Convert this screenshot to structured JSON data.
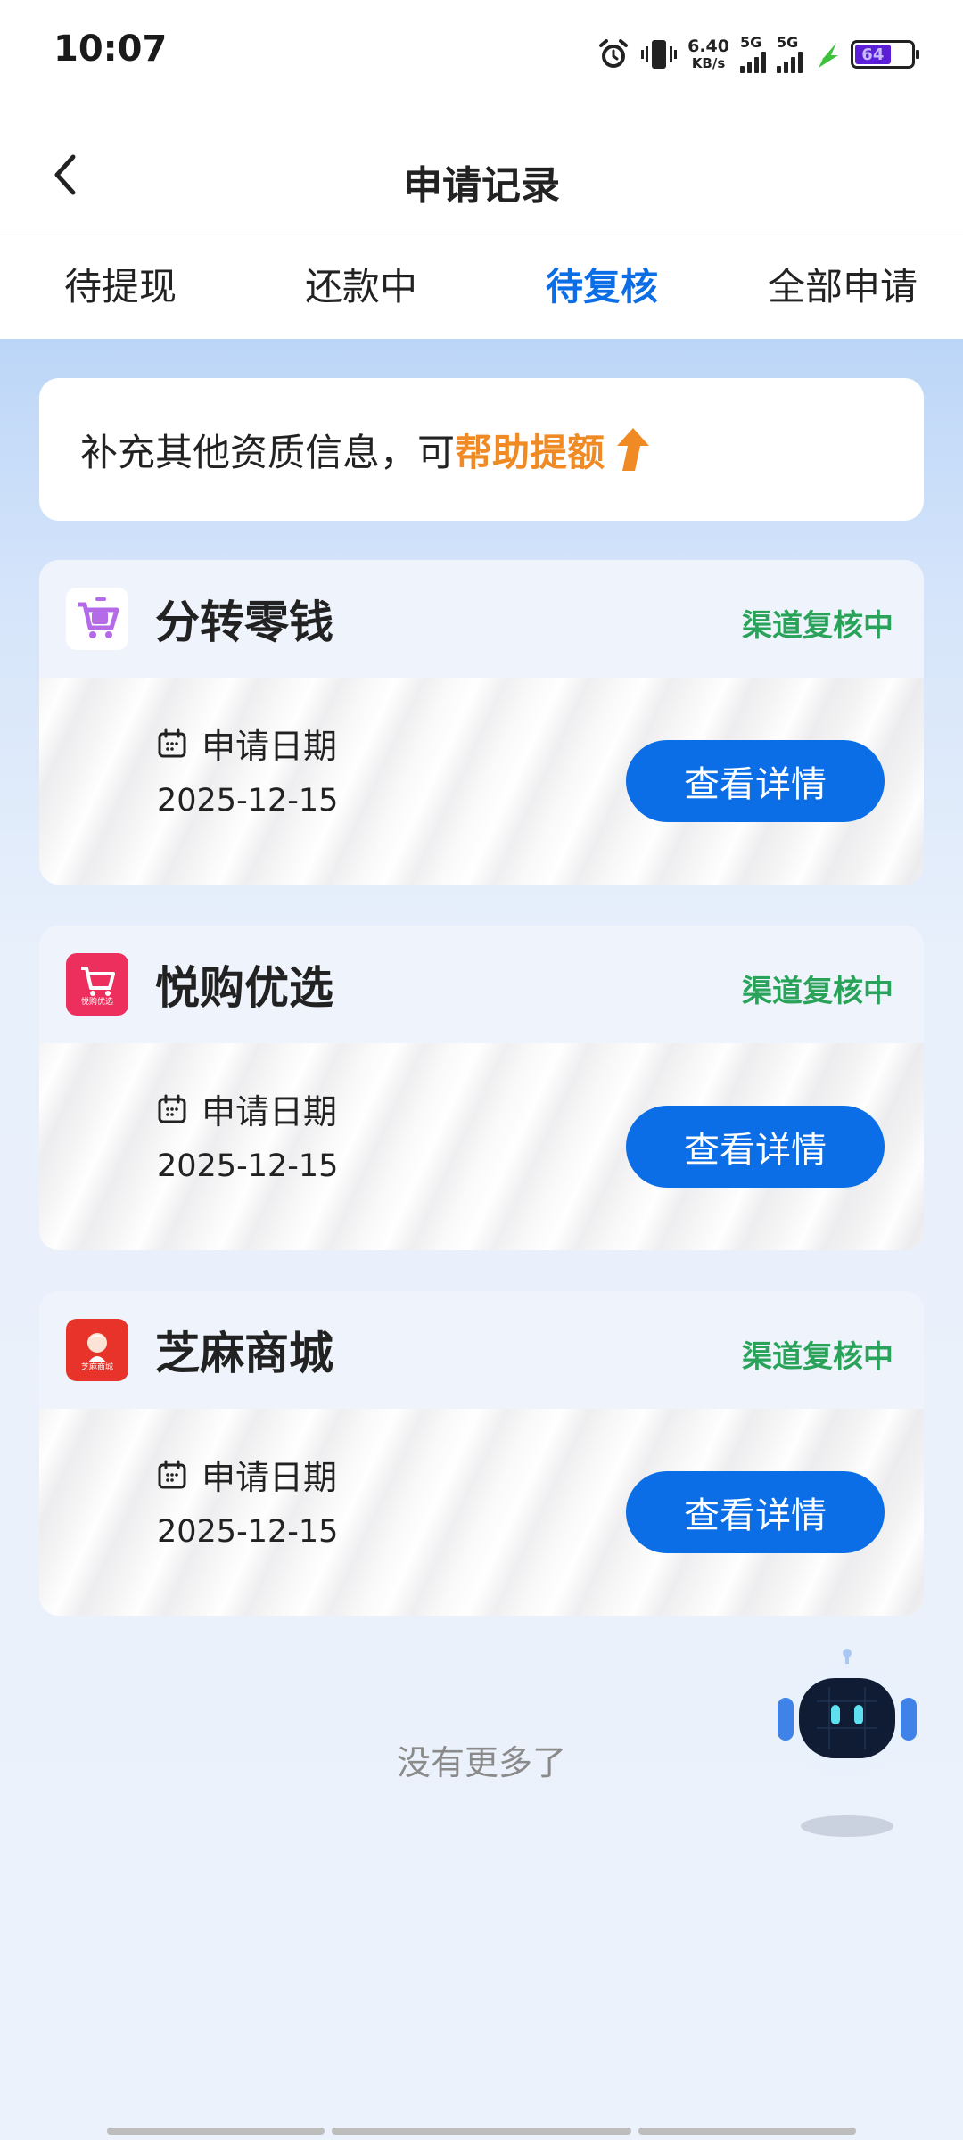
{
  "status_bar": {
    "time": "10:07",
    "net_speed_value": "6.40",
    "net_speed_unit": "KB/s",
    "sim1_label": "5G",
    "sim2_label": "5G",
    "battery_level": "64",
    "icons": [
      "alarm-icon",
      "vibrate-icon",
      "signal-icon",
      "signal-icon",
      "charging-icon",
      "battery-icon"
    ]
  },
  "header": {
    "title": "申请记录",
    "back_icon": "chevron-left-icon"
  },
  "tabs": [
    {
      "label": "待提现",
      "active": false
    },
    {
      "label": "还款中",
      "active": false
    },
    {
      "label": "待复核",
      "active": true
    },
    {
      "label": "全部申请",
      "active": false
    }
  ],
  "banner": {
    "text": "补充其他资质信息，可",
    "highlight": "帮助提额",
    "icon": "arrow-up-icon"
  },
  "records": [
    {
      "name": "分转零钱",
      "status": "渠道复核中",
      "date_label": "申请日期",
      "date": "2025-12-15",
      "button": "查看详情",
      "logo_color": "#b56be8",
      "logo_text": ""
    },
    {
      "name": "悦购优选",
      "status": "渠道复核中",
      "date_label": "申请日期",
      "date": "2025-12-15",
      "button": "查看详情",
      "logo_color": "#ec2f5c",
      "logo_text": "悦购优选"
    },
    {
      "name": "芝麻商城",
      "status": "渠道复核中",
      "date_label": "申请日期",
      "date": "2025-12-15",
      "button": "查看详情",
      "logo_color": "#e8332a",
      "logo_text": "芝麻商城"
    }
  ],
  "footer": {
    "no_more": "没有更多了"
  },
  "colors": {
    "accent": "#0b6ee6",
    "status_green": "#2aa35a",
    "highlight_orange": "#f08a24"
  }
}
